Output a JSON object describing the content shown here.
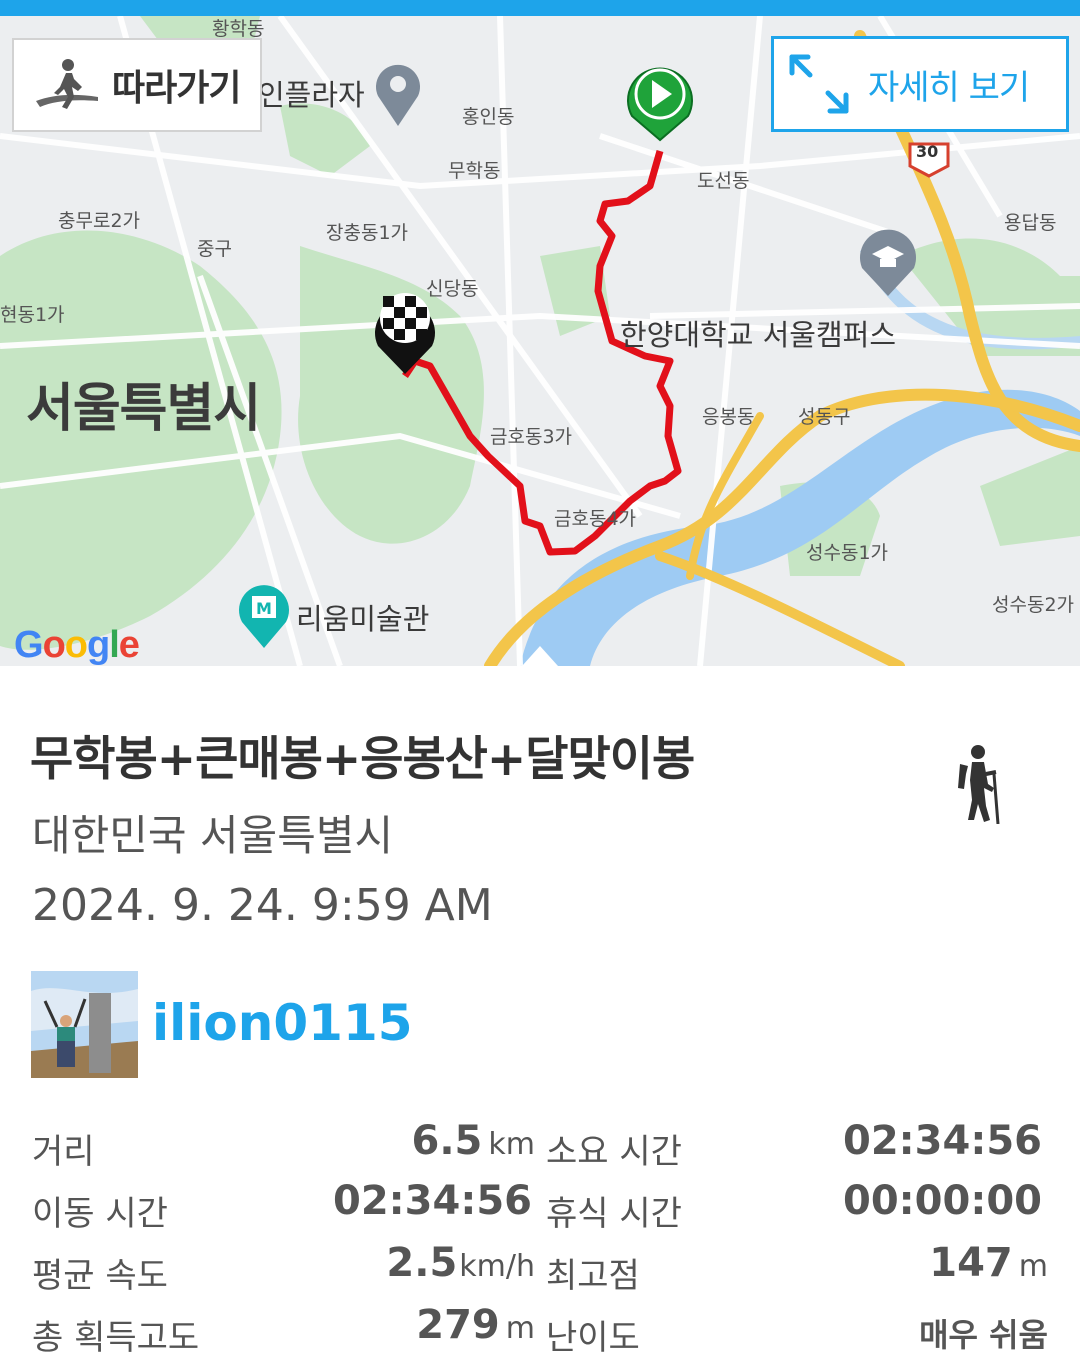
{
  "map": {
    "follow_label": "따라가기",
    "detail_label": "자세히 보기",
    "labels": {
      "city": "서울특별시",
      "plaza": "인플라자",
      "hongin": "홍인동",
      "muhak": "무학동",
      "doseon": "도선동",
      "chungmuro": "충무로2가",
      "junggu": "중구",
      "jangchung": "장충동1가",
      "sindang": "신당동",
      "hanyang": "한양대학교 서울캠퍼스",
      "yongdap": "용답동",
      "gwanghui": "현동1가",
      "eungbong": "응봉동",
      "seongdonggu": "성동구",
      "geumho3": "금호동3가",
      "geumho4": "금호동4가",
      "seongsu1": "성수동1가",
      "seongsu2": "성수동2가",
      "leeum": "리움미술관",
      "hwanghak": "황학동",
      "route30": "30"
    },
    "google": [
      "G",
      "o",
      "o",
      "g",
      "l",
      "e"
    ]
  },
  "track": {
    "title": "무학봉+큰매봉+응봉산+달맞이봉",
    "region": "대한민국 서울특별시",
    "datetime": "2024. 9. 24. 9:59 AM",
    "activity_icon": "hiker-icon",
    "user": "ilion0115"
  },
  "stats": {
    "distance_label": "거리",
    "distance_value": "6.5",
    "distance_unit": "km",
    "total_time_label": "소요 시간",
    "total_time_value": "02:34:56",
    "moving_time_label": "이동 시간",
    "moving_time_value": "02:34:56",
    "rest_time_label": "휴식 시간",
    "rest_time_value": "00:00:00",
    "avg_speed_label": "평균 속도",
    "avg_speed_value": "2.5",
    "avg_speed_unit": "km/h",
    "max_alt_label": "최고점",
    "max_alt_value": "147",
    "max_alt_unit": "m",
    "total_climb_label": "총 획득고도",
    "total_climb_value": "279",
    "total_climb_unit": "m",
    "difficulty_label": "난이도",
    "difficulty_value": "매우 쉬움"
  },
  "colors": {
    "accent": "#1ea4ea",
    "route": "#e2101a",
    "start_marker": "#1fa33a",
    "river": "#9ecbf3",
    "park": "#c6e5c4",
    "highway": "#f3c54a"
  }
}
